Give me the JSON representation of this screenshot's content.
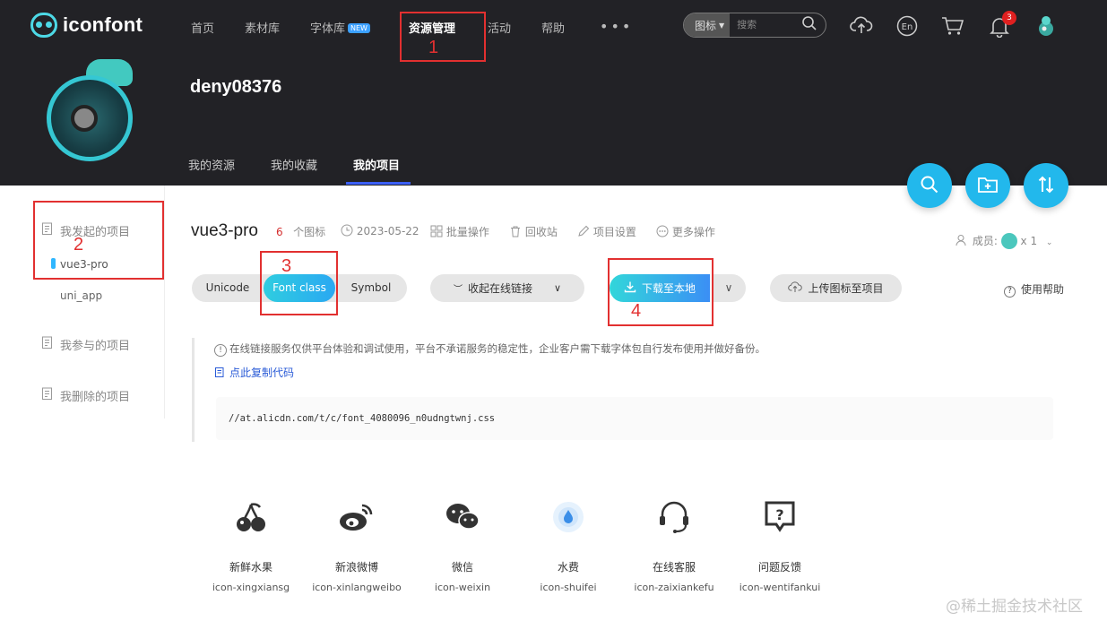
{
  "brand": {
    "logo_text": "iconfont"
  },
  "nav": {
    "items": [
      {
        "label": "首页"
      },
      {
        "label": "素材库"
      },
      {
        "label": "字体库",
        "badge": "NEW"
      },
      {
        "label": "资源管理"
      },
      {
        "label": "活动"
      },
      {
        "label": "帮助"
      }
    ],
    "more": "•••",
    "active": "资源管理"
  },
  "search": {
    "type": "图标",
    "placeholder": "搜索"
  },
  "notifications": {
    "count": "3"
  },
  "user": {
    "name": "deny08376"
  },
  "subtabs": [
    {
      "label": "我的资源"
    },
    {
      "label": "我的收藏"
    },
    {
      "label": "我的项目"
    }
  ],
  "sidebar": {
    "created": "我发起的项目",
    "projects": [
      "vue3-pro",
      "uni_app"
    ],
    "joined": "我参与的项目",
    "deleted": "我删除的项目"
  },
  "project": {
    "name": "vue3-pro",
    "icon_count": "6",
    "icon_count_label": "个图标",
    "date": "2023-05-22",
    "actions": [
      "批量操作",
      "回收站",
      "项目设置",
      "更多操作"
    ],
    "members_label": "成员:",
    "members_count": "x 1"
  },
  "toolbar": {
    "formats": [
      "Unicode",
      "Font class",
      "Symbol"
    ],
    "active_format": "Font class",
    "collapse_link": "收起在线链接",
    "download": "下载至本地",
    "upload": "上传图标至项目",
    "help": "使用帮助"
  },
  "code": {
    "notice": "在线链接服务仅供平台体验和调试使用，平台不承诺服务的稳定性，企业客户需下载字体包自行发布使用并做好备份。",
    "copy": "点此复制代码",
    "url": "//at.alicdn.com/t/c/font_4080096_n0udngtwnj.css"
  },
  "icons": [
    {
      "name": "新鲜水果",
      "class": "icon-xingxiansg",
      "icon": "cherry-icon"
    },
    {
      "name": "新浪微博",
      "class": "icon-xinlangweibo",
      "icon": "weibo-icon"
    },
    {
      "name": "微信",
      "class": "icon-weixin",
      "icon": "wechat-icon"
    },
    {
      "name": "水费",
      "class": "icon-shuifei",
      "icon": "water-drop-icon"
    },
    {
      "name": "在线客服",
      "class": "icon-zaixiankefu",
      "icon": "headset-icon"
    },
    {
      "name": "问题反馈",
      "class": "icon-wentifankui",
      "icon": "feedback-icon"
    }
  ],
  "annotations": [
    "1",
    "2",
    "3",
    "4"
  ],
  "watermark": "@稀土掘金技术社区",
  "colors": {
    "accent": "#22b8ec",
    "annotation": "#e23030",
    "header": "#222226"
  }
}
